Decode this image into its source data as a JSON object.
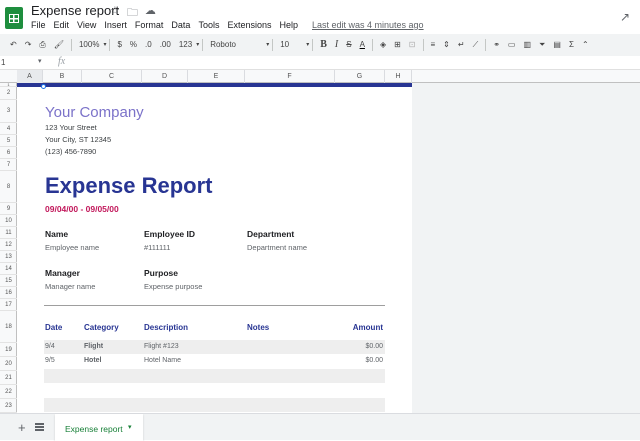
{
  "window": {
    "title": "Expense report",
    "menu": [
      "File",
      "Edit",
      "View",
      "Insert",
      "Format",
      "Data",
      "Tools",
      "Extensions",
      "Help"
    ],
    "last_edit": "Last edit was 4 minutes ago"
  },
  "toolbar": {
    "zoom": "100%",
    "currency": "$",
    "percent": "%",
    "dec_decrease": ".0",
    "dec_increase": ".00",
    "more_formats": "123",
    "font": "Roboto",
    "font_size": "10",
    "bold": "B",
    "italic": "I",
    "strike": "S",
    "text_color": "A",
    "icons": [
      "undo-icon",
      "redo-icon",
      "print-icon",
      "paint-format-icon",
      "borders-icon",
      "fill-color-icon",
      "merge-icon",
      "align-icon",
      "valign-icon",
      "wrap-icon",
      "rotate-icon",
      "link-icon",
      "comment-icon",
      "chart-icon",
      "filter-icon",
      "functions-icon"
    ]
  },
  "formula_bar": {
    "cell_ref": "1",
    "fx": "fx"
  },
  "columns": [
    "A",
    "B",
    "C",
    "D",
    "E",
    "F",
    "G",
    "H"
  ],
  "rows": [
    "1",
    "2",
    "3",
    "4",
    "5",
    "6",
    "7",
    "8",
    "9",
    "10",
    "11",
    "12",
    "13",
    "14",
    "15",
    "16",
    "17",
    "18",
    "19",
    "20",
    "21",
    "22",
    "23"
  ],
  "sheet": {
    "company": "Your Company",
    "address1": "123 Your Street",
    "address2": "Your City, ST 12345",
    "phone": "(123) 456-7890",
    "title": "Expense Report",
    "dates": "09/04/00 - 09/05/00",
    "name_label": "Name",
    "name_value": "Employee name",
    "empid_label": "Employee ID",
    "empid_value": "#111111",
    "dept_label": "Department",
    "dept_value": "Department name",
    "manager_label": "Manager",
    "manager_value": "Manager name",
    "purpose_label": "Purpose",
    "purpose_value": "Expense purpose",
    "table_headers": {
      "date": "Date",
      "category": "Category",
      "description": "Description",
      "notes": "Notes",
      "amount": "Amount"
    },
    "table_rows": [
      {
        "date": "9/4",
        "category": "Flight",
        "description": "Flight #123",
        "notes": "",
        "amount": "$0.00"
      },
      {
        "date": "9/5",
        "category": "Hotel",
        "description": "Hotel Name",
        "notes": "",
        "amount": "$0.00"
      }
    ]
  },
  "bottom": {
    "sheet_tab": "Expense report"
  },
  "colors": {
    "navy": "#283593",
    "company_purple": "#7b72c9",
    "date_pink": "#c2185b",
    "sheets_green": "#1e8e3e"
  }
}
